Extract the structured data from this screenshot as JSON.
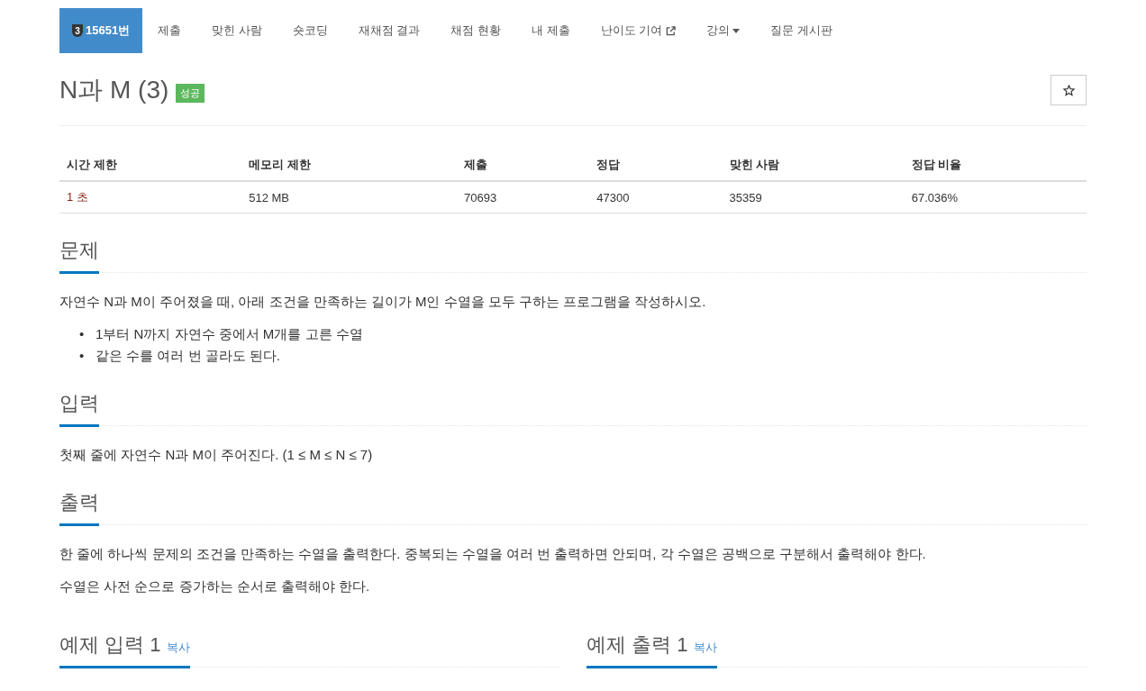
{
  "nav": {
    "items": [
      {
        "label": "15651번",
        "badge": "3",
        "selected": true,
        "kind": "tab"
      },
      {
        "label": "제출",
        "selected": false,
        "kind": "tab"
      },
      {
        "label": "맞힌 사람",
        "selected": false,
        "kind": "tab"
      },
      {
        "label": "숏코딩",
        "selected": false,
        "kind": "tab"
      },
      {
        "label": "재채점 결과",
        "selected": false,
        "kind": "tab"
      },
      {
        "label": "채점 현황",
        "selected": false,
        "kind": "tab"
      },
      {
        "label": "내 제출",
        "selected": false,
        "kind": "tab"
      },
      {
        "label": "난이도 기여",
        "selected": false,
        "kind": "external"
      },
      {
        "label": "강의",
        "selected": false,
        "kind": "dropdown"
      },
      {
        "label": "질문 게시판",
        "selected": false,
        "kind": "tab"
      }
    ]
  },
  "problem": {
    "title": "N과 M (3)",
    "status": "성공",
    "starred": false
  },
  "info_table": {
    "columns": [
      "시간 제한",
      "메모리 제한",
      "제출",
      "정답",
      "맞힌 사람",
      "정답 비율"
    ],
    "rows": [
      [
        "1 초",
        "512 MB",
        "70693",
        "47300",
        "35359",
        "67.036%"
      ]
    ]
  },
  "sections": [
    {
      "heading": "문제",
      "paragraphs": [
        "자연수 N과 M이 주어졌을 때, 아래 조건을 만족하는 길이가 M인 수열을 모두 구하는 프로그램을 작성하시오."
      ],
      "bullets": [
        {
          "marker": "•",
          "text": "1부터 N까지 자연수 중에서 M개를 고른 수열"
        },
        {
          "marker": "•",
          "text": "같은 수를 여러 번 골라도 된다."
        }
      ]
    },
    {
      "heading": "입력",
      "paragraphs": [
        "첫째 줄에 자연수 N과 M이 주어진다. (1 ≤ M ≤ N ≤ 7)"
      ]
    },
    {
      "heading": "출력",
      "paragraphs": [
        "한 줄에 하나씩 문제의 조건을 만족하는 수열을 출력한다. 중복되는 수열을 여러 번 출력하면 안되며, 각 수열은 공백으로 구분해서 출력해야 한다.",
        "수열은 사전 순으로 증가하는 순서로 출력해야 한다."
      ]
    }
  ],
  "examples": [
    {
      "heading": "예제 입력 1",
      "copy": "복사"
    },
    {
      "heading": "예제 출력 1",
      "copy": "복사"
    }
  ]
}
